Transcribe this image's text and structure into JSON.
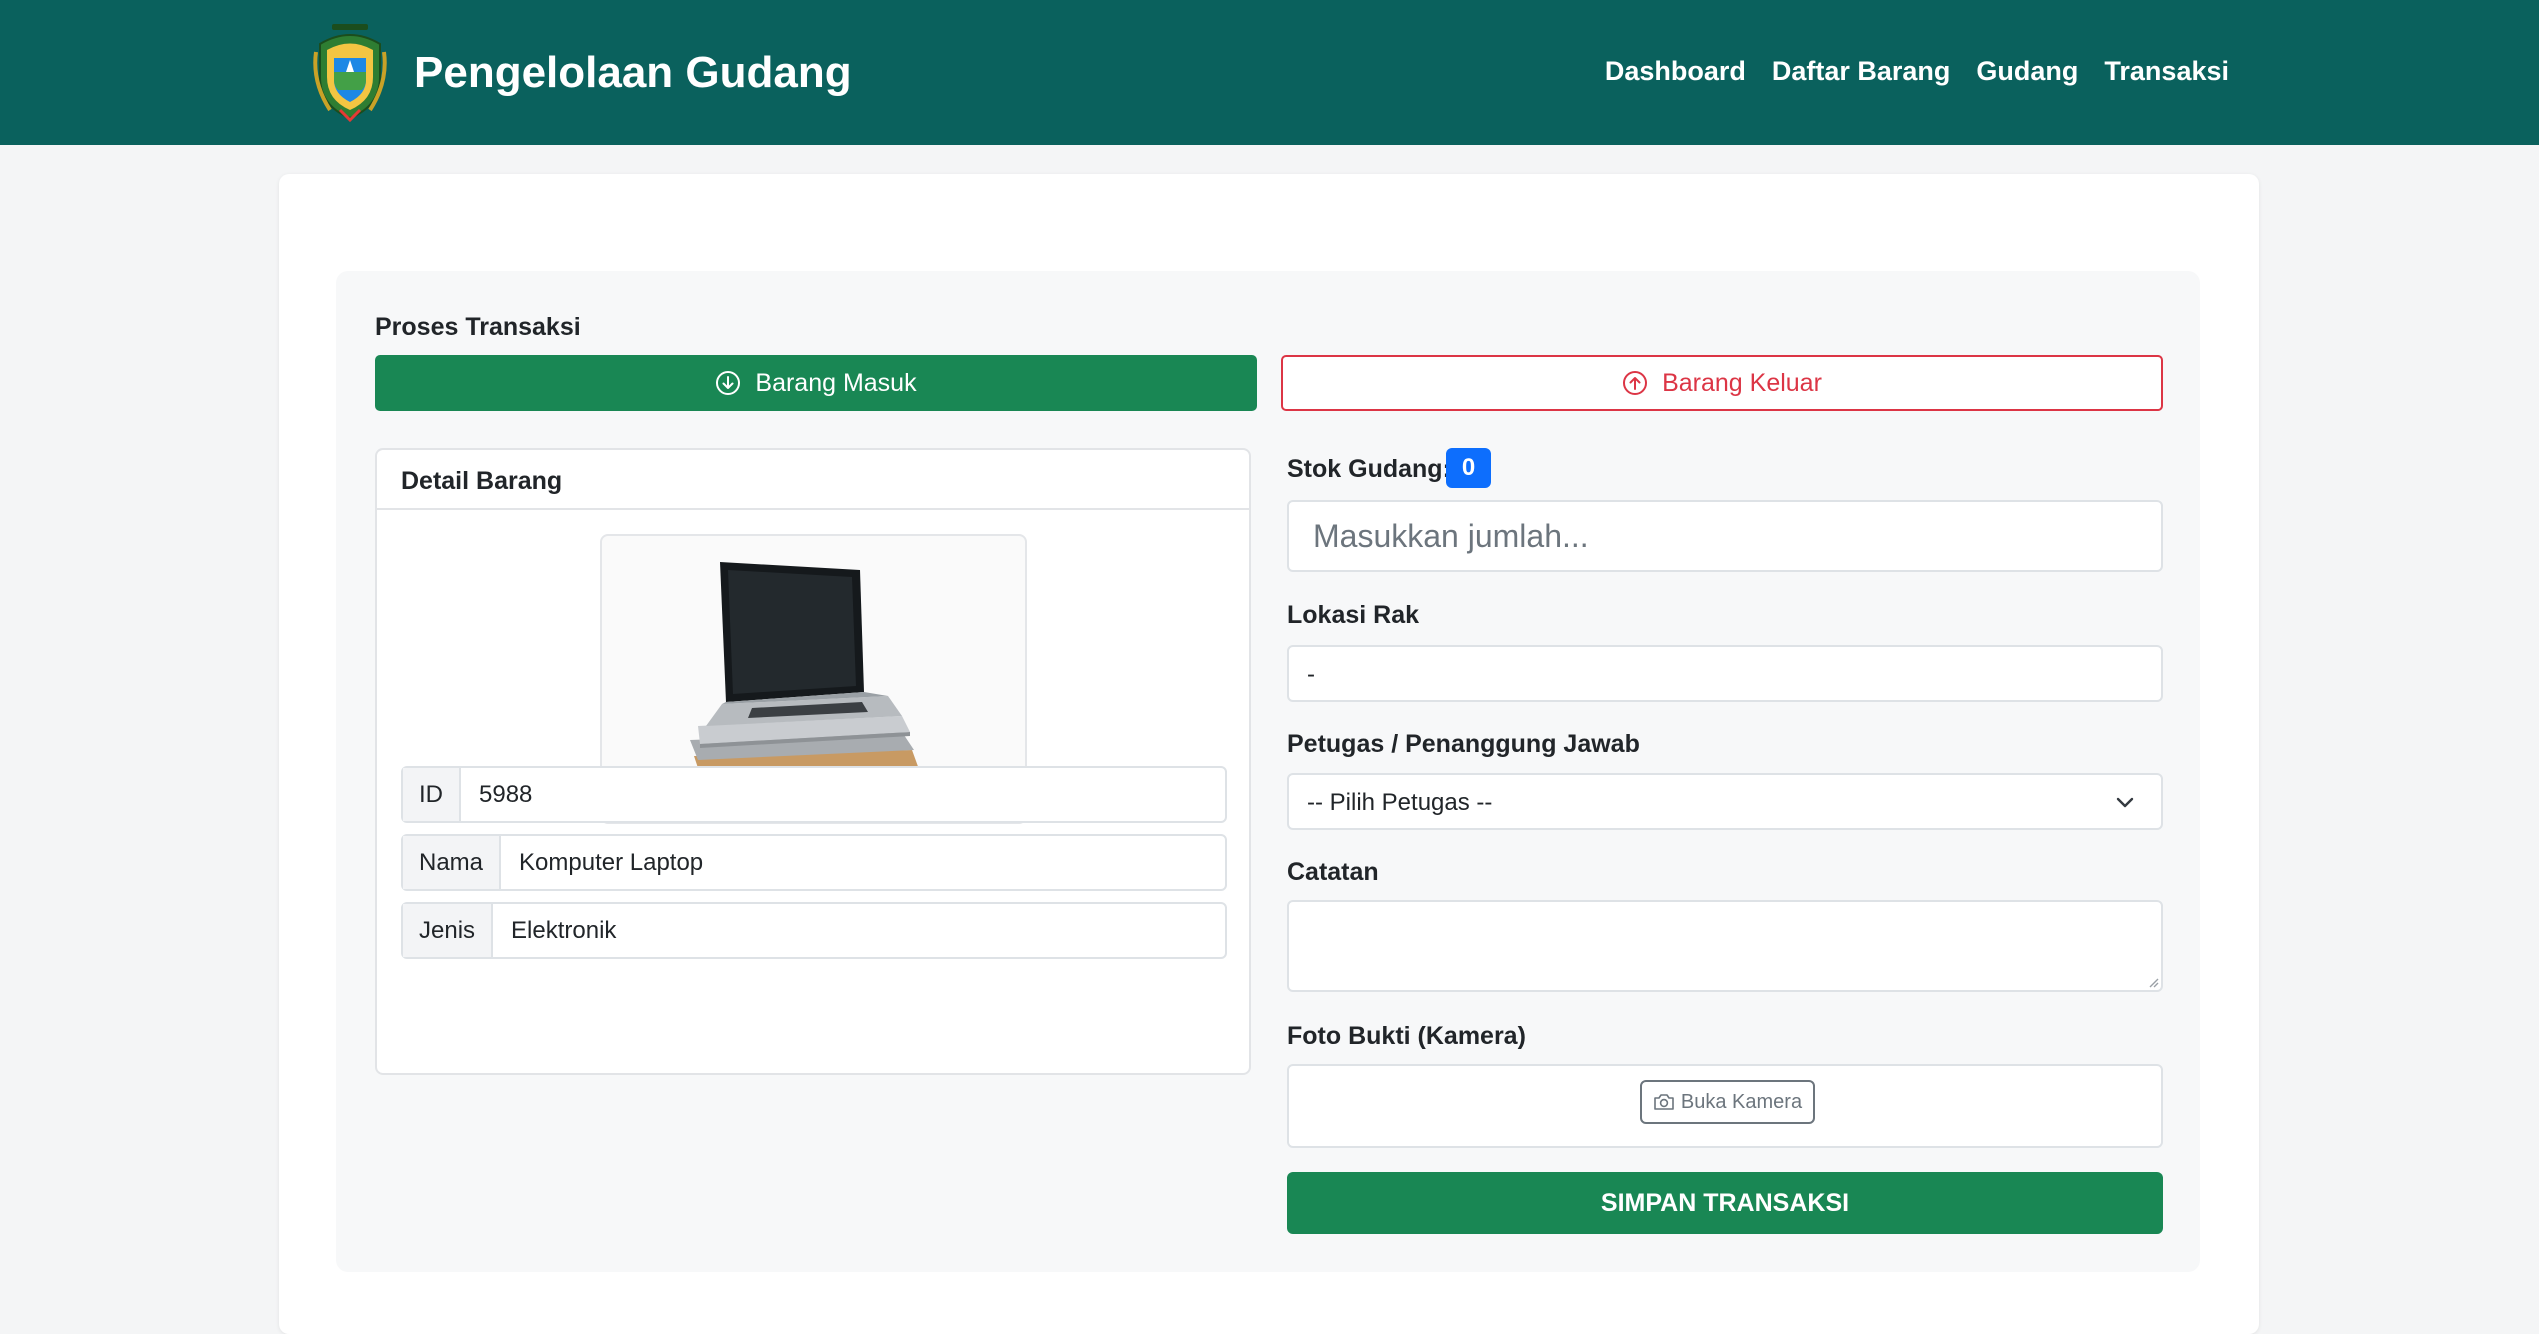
{
  "header": {
    "title": "Pengelolaan Gudang",
    "nav": [
      "Dashboard",
      "Daftar Barang",
      "Gudang",
      "Transaksi"
    ]
  },
  "transaction": {
    "section_label": "Proses Transaksi",
    "btn_in": "Barang Masuk",
    "btn_out": "Barang Keluar"
  },
  "detail": {
    "title": "Detail Barang",
    "image_icon": "laptop-photo",
    "fields": [
      {
        "label": "ID",
        "value": "5988"
      },
      {
        "label": "Nama",
        "value": "Komputer Laptop"
      },
      {
        "label": "Jenis",
        "value": "Elektronik"
      }
    ]
  },
  "form": {
    "stock_label": "Stok Gudang:",
    "stock_value": "0",
    "qty_placeholder": "Masukkan jumlah...",
    "rak_label": "Lokasi Rak",
    "rak_value": "-",
    "officer_label": "Petugas / Penanggung Jawab",
    "officer_selected": "-- Pilih Petugas --",
    "notes_label": "Catatan",
    "photo_label": "Foto Bukti (Kamera)",
    "camera_button": "Buka Kamera",
    "save_button": "SIMPAN TRANSAKSI"
  },
  "colors": {
    "navbar": "#0a615d",
    "success": "#198754",
    "danger": "#dc3545",
    "primary": "#0d6efd"
  }
}
